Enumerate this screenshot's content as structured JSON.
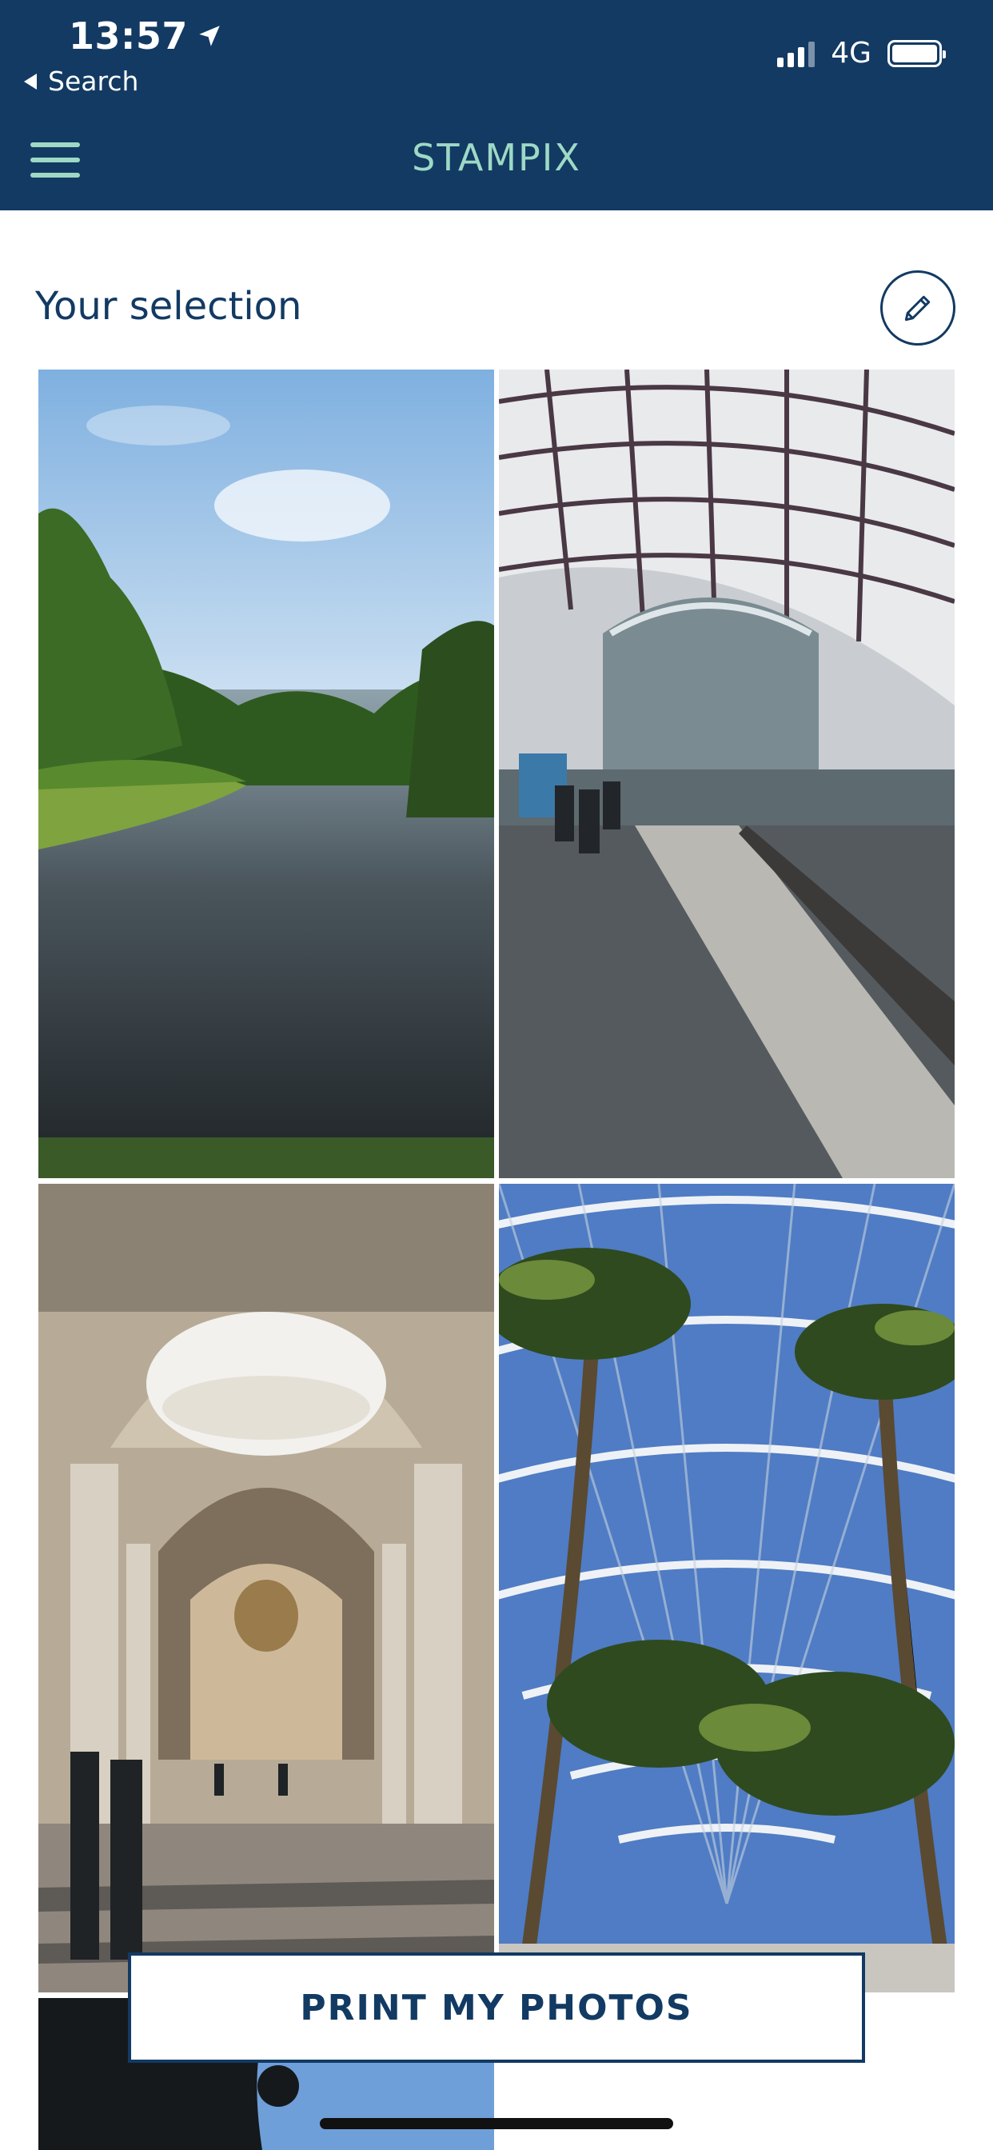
{
  "status_bar": {
    "time": "13:57",
    "back_label": "Search",
    "network": "4G",
    "icons": [
      "location-arrow-icon",
      "signal-bars-icon",
      "battery-icon"
    ]
  },
  "nav": {
    "title": "STAMPIX",
    "menu_icon": "hamburger-menu-icon"
  },
  "selection": {
    "title": "Your selection",
    "edit_icon": "pencil-icon",
    "photos": [
      {
        "subject": "park-river"
      },
      {
        "subject": "train-station"
      },
      {
        "subject": "domed-hall"
      },
      {
        "subject": "palm-arcade"
      },
      {
        "subject": "tree-sky"
      }
    ]
  },
  "actions": {
    "print_label": "PRINT MY PHOTOS"
  },
  "colors": {
    "header_bg": "#123a63",
    "accent": "#9ed9c5",
    "text_dark": "#123a63"
  }
}
